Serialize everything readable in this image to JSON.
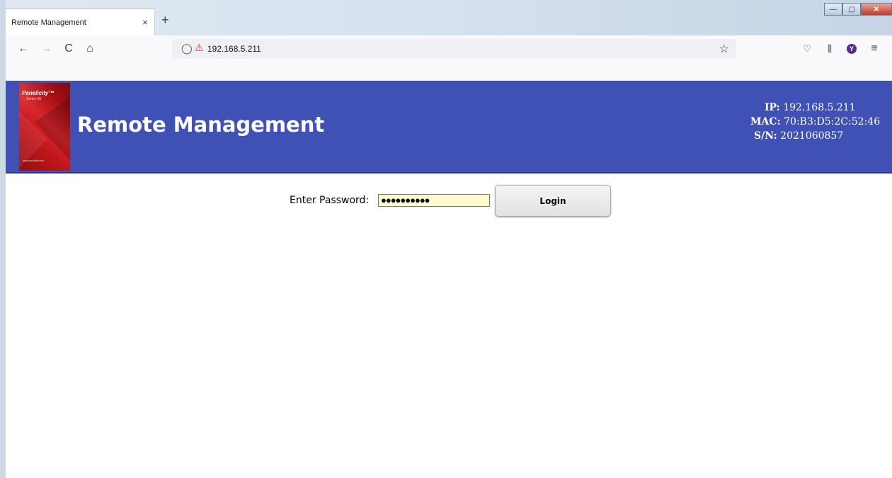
{
  "browser": {
    "tab_title": "Remote Management",
    "tab_close": "×",
    "new_tab": "+",
    "url": "192.168.5.211",
    "icons": {
      "back": "←",
      "forward": "→",
      "reload": "C",
      "home": "⌂",
      "shield": "◯",
      "lock": "⚠",
      "bookmark": "☆",
      "pocket": "♡",
      "library": "⫼",
      "menu": "≡"
    },
    "avatar_letter": "Y",
    "window_controls": {
      "minimize": "—",
      "maximize": "▢",
      "close": "✕"
    }
  },
  "header": {
    "title": "Remote Management",
    "background_color": "#3f51b5",
    "logo": {
      "brand": "Panelicity™",
      "series": "Series 36",
      "web": "www.panelicity.com"
    },
    "device_info": {
      "ip_label": "IP:",
      "ip_value": "192.168.5.211",
      "mac_label": "MAC:",
      "mac_value": "70:B3:D5:2C:52:46",
      "sn_label": "S/N:",
      "sn_value": "2021060857"
    }
  },
  "login": {
    "password_label": "Enter Password:",
    "password_masked": "●●●●●●●●●●",
    "button_label": "Login"
  }
}
